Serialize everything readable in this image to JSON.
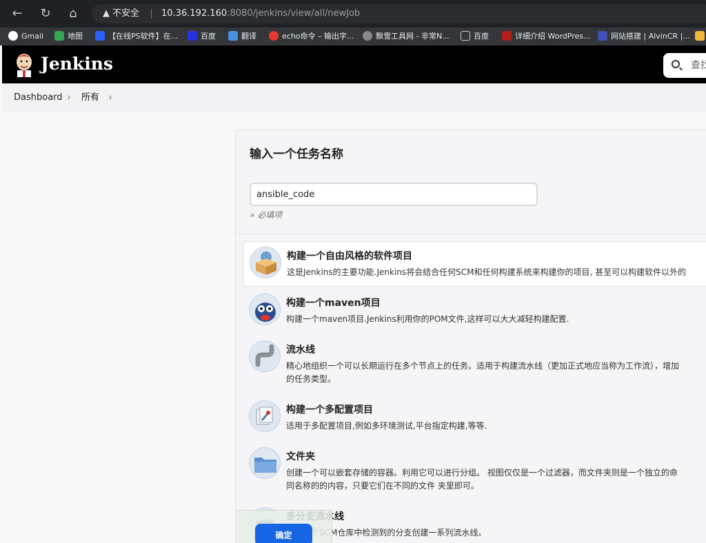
{
  "browser": {
    "security_label": "不安全",
    "url_host": "10.36.192.160",
    "url_rest": ":8080/jenkins/view/all/newJob",
    "bookmarks": [
      {
        "label": "Gmail",
        "color": "#ea4335"
      },
      {
        "label": "地图",
        "color": "#34a853"
      },
      {
        "label": "【在线PS软件】在...",
        "color": "#2962ff"
      },
      {
        "label": "百度",
        "color": "#2932e1"
      },
      {
        "label": "翻译",
        "color": "#4a90e2"
      },
      {
        "label": "echo命令 – 输出字...",
        "color": "#e53935"
      },
      {
        "label": "飘雪工具网 - 非常N...",
        "color": "#888888"
      },
      {
        "label": "百度",
        "color": "#9e9e9e"
      },
      {
        "label": "详细介绍 WordPres...",
        "color": "#b71c1c"
      },
      {
        "label": "网站搭建 | AlvinCR |...",
        "color": "#3f51b5"
      }
    ]
  },
  "header": {
    "brand": "Jenkins",
    "search_placeholder": "查找"
  },
  "breadcrumb": {
    "items": [
      "Dashboard",
      "所有"
    ]
  },
  "form": {
    "title": "输入一个任务名称",
    "name_value": "ansible_code",
    "required_hint": "» 必填项"
  },
  "job_types": [
    {
      "name": "构建一个自由风格的软件项目",
      "desc": [
        "这是Jenkins的主要功能.Jenkins将会结合任何SCM和任何构建系统来构建你的项目, 甚至可以构建软件以外的"
      ],
      "icon": "freestyle-icon"
    },
    {
      "name": "构建一个maven项目",
      "desc": [
        "构建一个maven项目.Jenkins利用你的POM文件,这样可以大大减轻构建配置."
      ],
      "icon": "maven-icon"
    },
    {
      "name": "流水线",
      "desc": [
        "精心地组织一个可以长期运行在多个节点上的任务。适用于构建流水线（更加正式地应当称为工作流），增加",
        "的任务类型。"
      ],
      "icon": "pipeline-icon"
    },
    {
      "name": "构建一个多配置项目",
      "desc": [
        "适用于多配置项目,例如多环境测试,平台指定构建,等等."
      ],
      "icon": "multiconfig-icon"
    },
    {
      "name": "文件夹",
      "desc": [
        "创建一个可以嵌套存储的容器。利用它可以进行分组。 视图仅仅是一个过滤器，而文件夹则是一个独立的命",
        "同名称的的内容，只要它们在不同的文件 夹里即可。"
      ],
      "icon": "folder-icon"
    },
    {
      "name": "多分支流水线",
      "desc": [
        "根据一个SCM仓库中检测到的分支创建一系列流水线。"
      ],
      "icon": "multibranch-icon"
    }
  ],
  "footer": {
    "ok_label": "确定"
  }
}
